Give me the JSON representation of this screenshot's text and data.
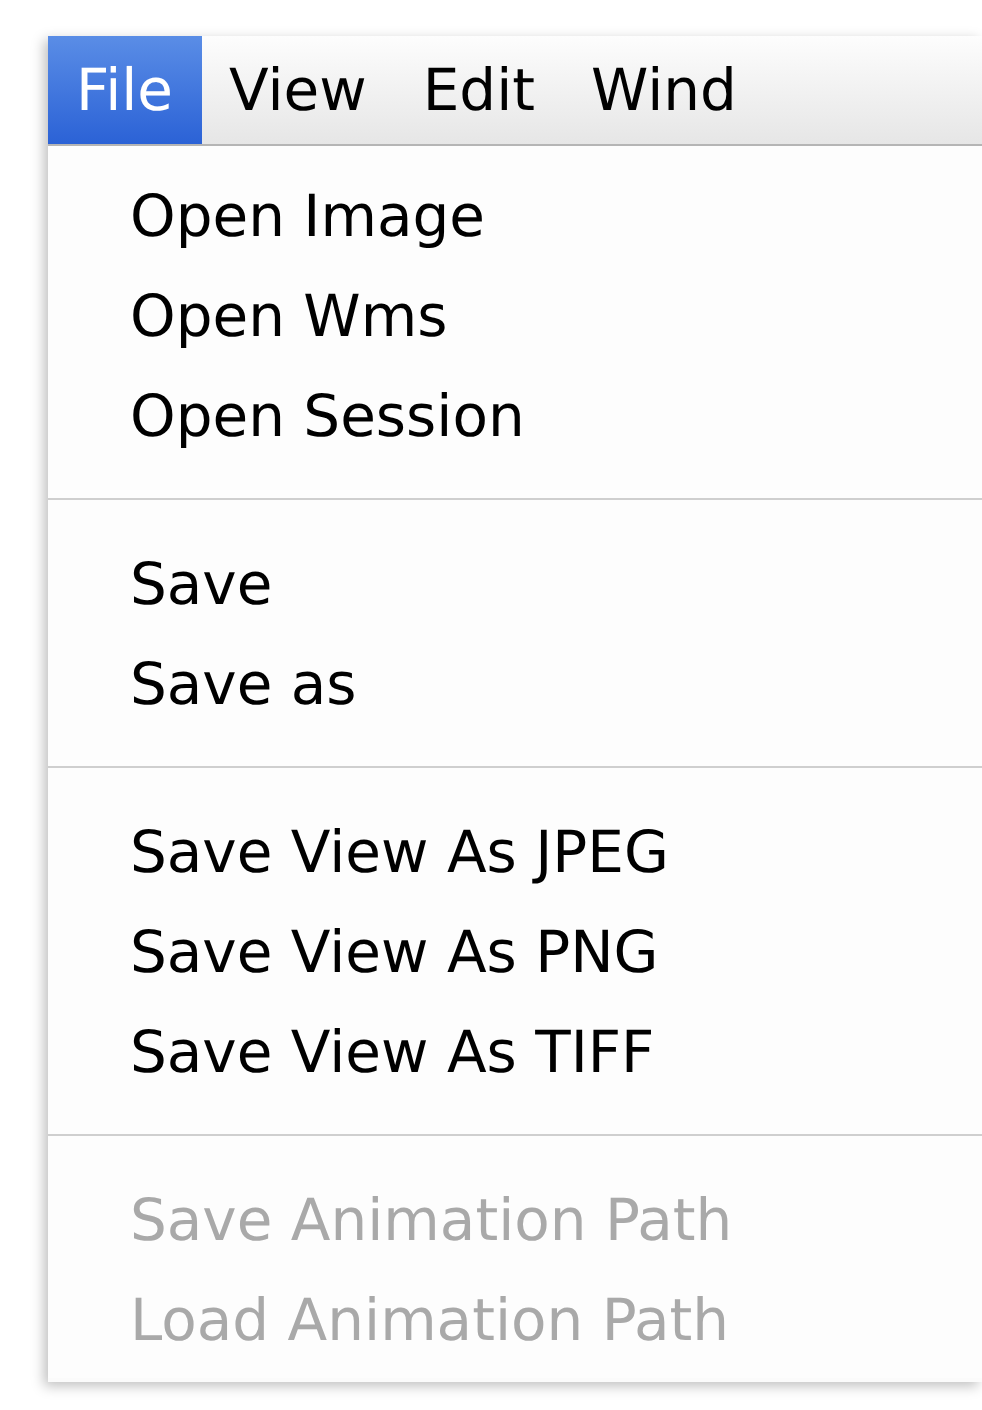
{
  "menu_bar": {
    "items": [
      {
        "label": "File",
        "selected": true
      },
      {
        "label": "View",
        "selected": false
      },
      {
        "label": "Edit",
        "selected": false
      },
      {
        "label": "Wind",
        "selected": false
      }
    ]
  },
  "file_menu": {
    "items": [
      {
        "kind": "item",
        "label": "Open Image",
        "disabled": false
      },
      {
        "kind": "item",
        "label": "Open Wms",
        "disabled": false
      },
      {
        "kind": "item",
        "label": "Open Session",
        "disabled": false
      },
      {
        "kind": "separator"
      },
      {
        "kind": "item",
        "label": "Save",
        "disabled": false
      },
      {
        "kind": "item",
        "label": "Save as",
        "disabled": false
      },
      {
        "kind": "separator"
      },
      {
        "kind": "item",
        "label": "Save View As JPEG",
        "disabled": false
      },
      {
        "kind": "item",
        "label": "Save View As PNG",
        "disabled": false
      },
      {
        "kind": "item",
        "label": "Save View As TIFF",
        "disabled": false
      },
      {
        "kind": "separator"
      },
      {
        "kind": "item",
        "label": "Save Animation Path",
        "disabled": true
      },
      {
        "kind": "item",
        "label": "Load Animation Path",
        "disabled": true
      }
    ]
  }
}
